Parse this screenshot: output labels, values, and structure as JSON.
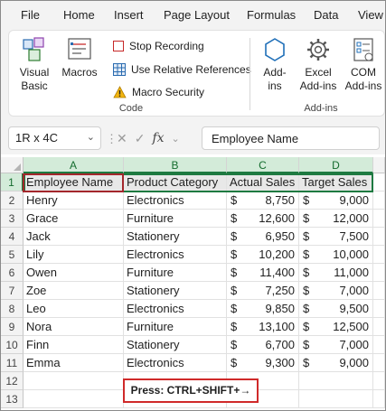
{
  "menu": {
    "tabs": [
      {
        "label": "File"
      },
      {
        "label": "Home"
      },
      {
        "label": "Insert"
      },
      {
        "label": "Page Layout"
      },
      {
        "label": "Formulas"
      },
      {
        "label": "Data"
      },
      {
        "label": "View"
      }
    ]
  },
  "ribbon": {
    "code_group": {
      "visual_basic_label": "Visual\nBasic",
      "macros_label": "Macros",
      "stop_recording_label": "Stop Recording",
      "relative_refs_label": "Use Relative References",
      "macro_security_label": "Macro Security",
      "group_label": "Code"
    },
    "addins_group": {
      "addins_label": "Add-\nins",
      "excel_addins_label": "Excel\nAdd-ins",
      "com_addins_label": "COM\nAdd-ins",
      "group_label": "Add-ins"
    }
  },
  "formula_bar": {
    "name_box": "1R x 4C",
    "content": "Employee Name"
  },
  "sheet": {
    "columns": [
      "A",
      "B",
      "C",
      "D"
    ],
    "rows": [
      "1",
      "2",
      "3",
      "4",
      "5",
      "6",
      "7",
      "8",
      "9",
      "10",
      "11",
      "12",
      "13"
    ],
    "header": [
      "Employee Name",
      "Product Category",
      "Actual Sales",
      "Target Sales"
    ],
    "currency_symbol": "$",
    "data": [
      [
        "Henry",
        "Electronics",
        "8,750",
        "9,000"
      ],
      [
        "Grace",
        "Furniture",
        "12,600",
        "12,000"
      ],
      [
        "Jack",
        "Stationery",
        "6,950",
        "7,500"
      ],
      [
        "Lily",
        "Electronics",
        "10,200",
        "10,000"
      ],
      [
        "Owen",
        "Furniture",
        "11,400",
        "11,000"
      ],
      [
        "Zoe",
        "Stationery",
        "7,250",
        "7,000"
      ],
      [
        "Leo",
        "Electronics",
        "9,850",
        "9,500"
      ],
      [
        "Nora",
        "Furniture",
        "13,100",
        "12,500"
      ],
      [
        "Finn",
        "Stationery",
        "6,700",
        "7,000"
      ],
      [
        "Emma",
        "Electronics",
        "9,300",
        "9,000"
      ]
    ]
  },
  "callout": {
    "text": "Press: CTRL+SHIFT+→"
  },
  "colors": {
    "selection_green": "#1e7a41",
    "active_cell_red": "#a4262c",
    "callout_border": "#d02a2a"
  }
}
